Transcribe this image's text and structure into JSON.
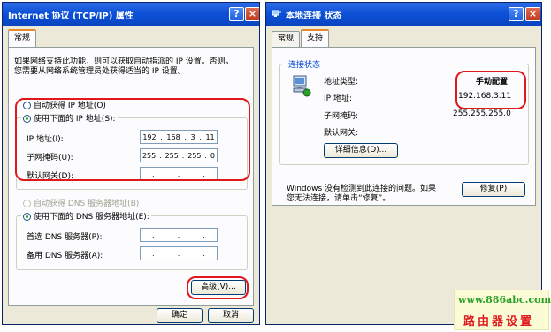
{
  "left_dialog": {
    "title": "Internet 协议 (TCP/IP) 属性",
    "help_label": "?",
    "close_label": "×",
    "tab_general": "常规",
    "description_line1": "如果网络支持此功能，则可以获取自动指派的 IP 设置。否则，",
    "description_line2": "您需要从网络系统管理员处获得适当的 IP 设置。",
    "radio_auto_ip": "自动获得 IP 地址(O)",
    "radio_manual_ip": "使用下面的 IP 地址(S):",
    "ip_label": "IP 地址(I):",
    "ip_value": [
      "192",
      "168",
      "3",
      "11"
    ],
    "mask_label": "子网掩码(U):",
    "mask_value": [
      "255",
      "255",
      "255",
      "0"
    ],
    "gateway_label": "默认网关(D):",
    "gateway_value": [
      ".",
      ".",
      "."
    ],
    "radio_auto_dns": "自动获得 DNS 服务器地址(B)",
    "radio_manual_dns": "使用下面的 DNS 服务器地址(E):",
    "dns1_label": "首选 DNS 服务器(P):",
    "dns2_label": "备用 DNS 服务器(A):",
    "dns_value": [
      ".",
      ".",
      "."
    ],
    "advanced_button": "高级(V)...",
    "ok_button": "确定",
    "cancel_button": "取消"
  },
  "right_dialog": {
    "title": "本地连接 状态",
    "help_label": "?",
    "close_label": "×",
    "tab_general": "常规",
    "tab_support": "支持",
    "group_label": "连接状态",
    "addr_type_label": "地址类型:",
    "addr_type_value": "手动配置",
    "ip_label": "IP 地址:",
    "ip_value": "192.168.3.11",
    "mask_label": "子网掩码:",
    "mask_value": "255.255.255.0",
    "gateway_label": "默认网关:",
    "details_button": "详细信息(D)...",
    "repair_text_line1": "Windows 没有检测到此连接的问题。如果",
    "repair_text_line2": "您无法连接，请单击“修复”。",
    "repair_button": "修复(P)"
  },
  "watermark": {
    "url": "www.886abc.com",
    "text": "路由器设置"
  }
}
